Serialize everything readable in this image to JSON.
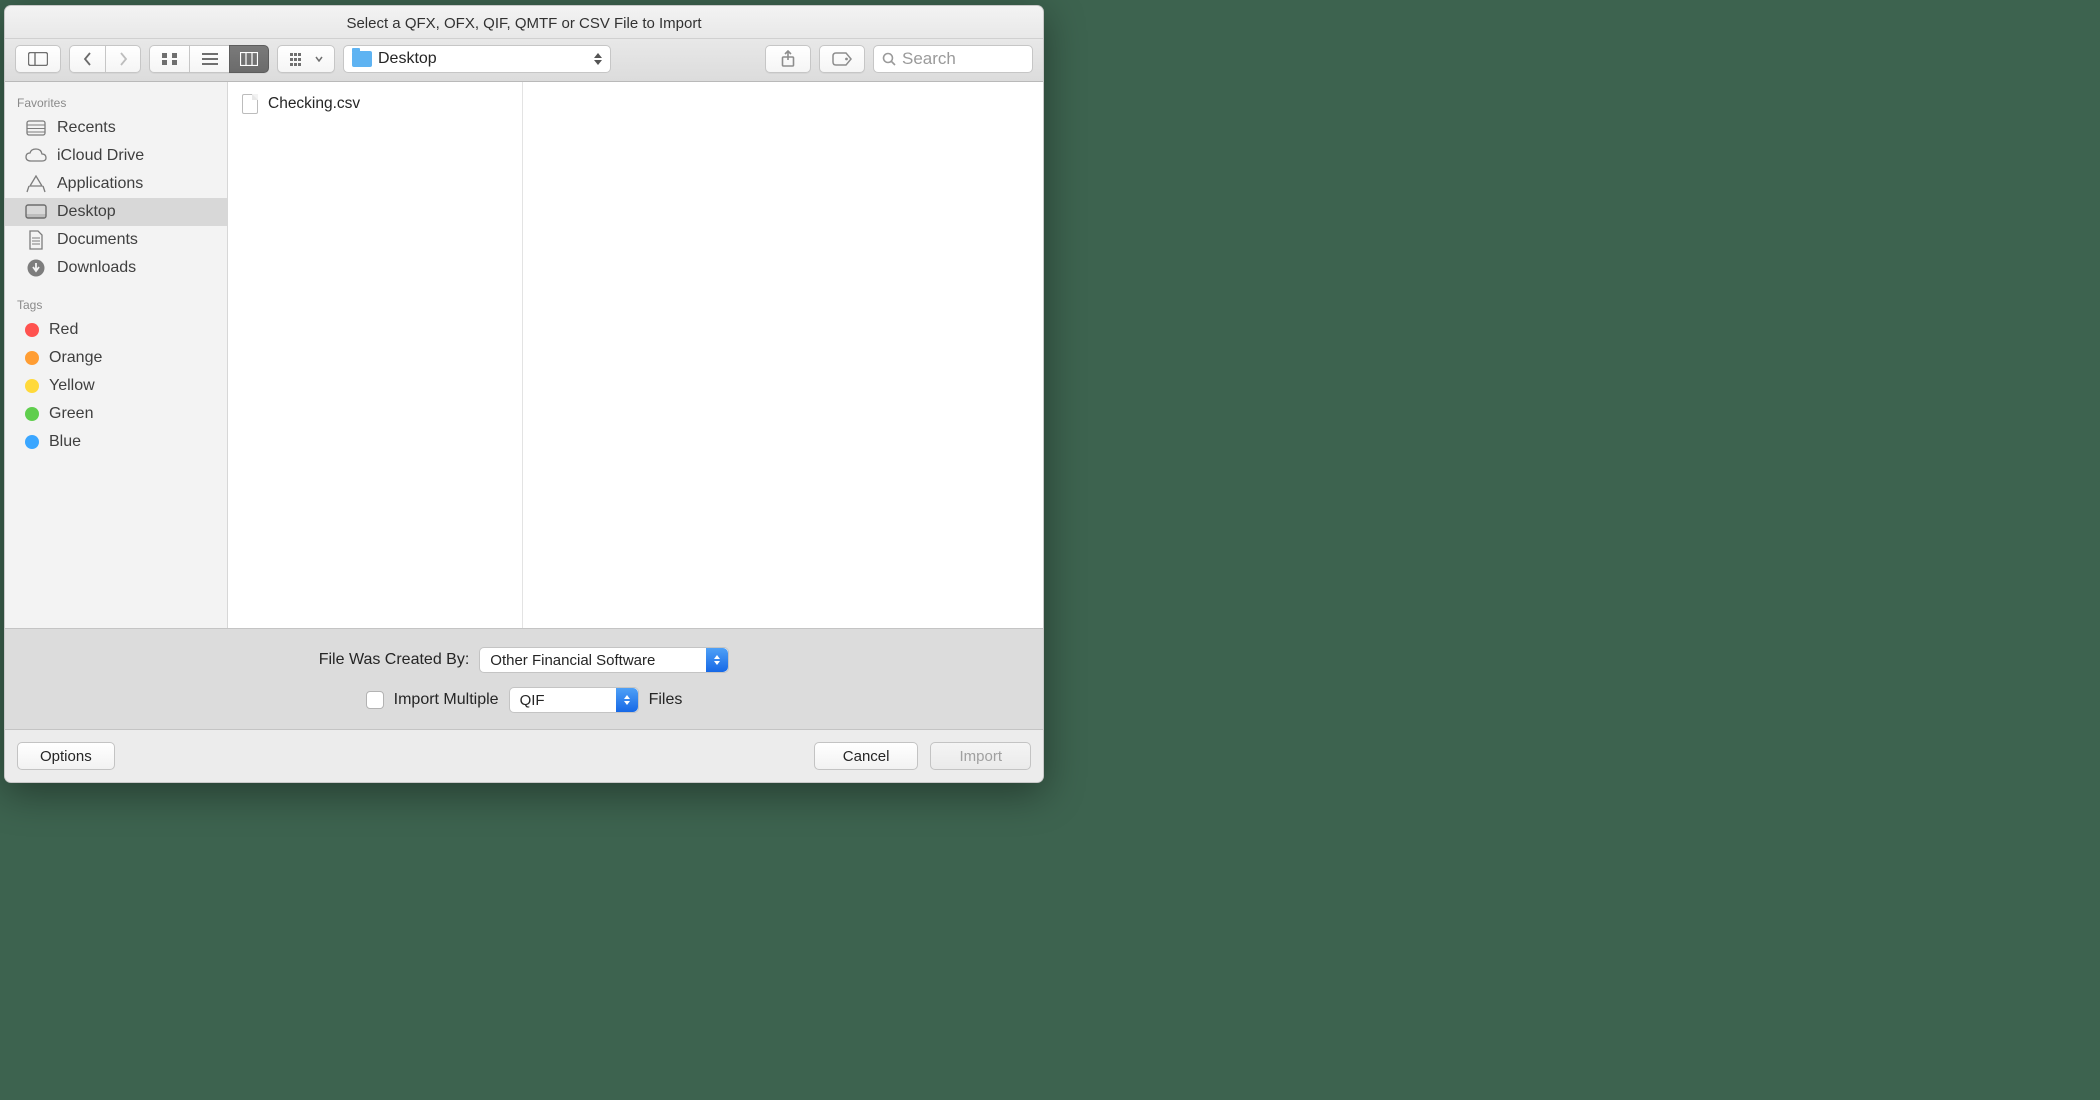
{
  "title": "Select a QFX, OFX, QIF, QMTF or CSV File to Import",
  "location": {
    "folder": "Desktop"
  },
  "search": {
    "placeholder": "Search"
  },
  "sidebar": {
    "sections": {
      "favorites_header": "Favorites",
      "tags_header": "Tags"
    },
    "favorites": [
      {
        "label": "Recents"
      },
      {
        "label": "iCloud Drive"
      },
      {
        "label": "Applications"
      },
      {
        "label": "Desktop"
      },
      {
        "label": "Documents"
      },
      {
        "label": "Downloads"
      }
    ],
    "tags": [
      {
        "label": "Red",
        "color": "#ff524f"
      },
      {
        "label": "Orange",
        "color": "#ff9d33"
      },
      {
        "label": "Yellow",
        "color": "#ffd93b"
      },
      {
        "label": "Green",
        "color": "#5fce4d"
      },
      {
        "label": "Blue",
        "color": "#3aa6ff"
      }
    ]
  },
  "files": [
    {
      "name": "Checking.csv"
    }
  ],
  "options": {
    "created_by_label": "File Was Created By:",
    "created_by_value": "Other Financial Software",
    "import_multiple_label": "Import Multiple",
    "import_multiple_checked": false,
    "multiple_format_value": "QIF",
    "files_label_suffix": "Files"
  },
  "footer": {
    "options_label": "Options",
    "cancel_label": "Cancel",
    "import_label": "Import"
  }
}
